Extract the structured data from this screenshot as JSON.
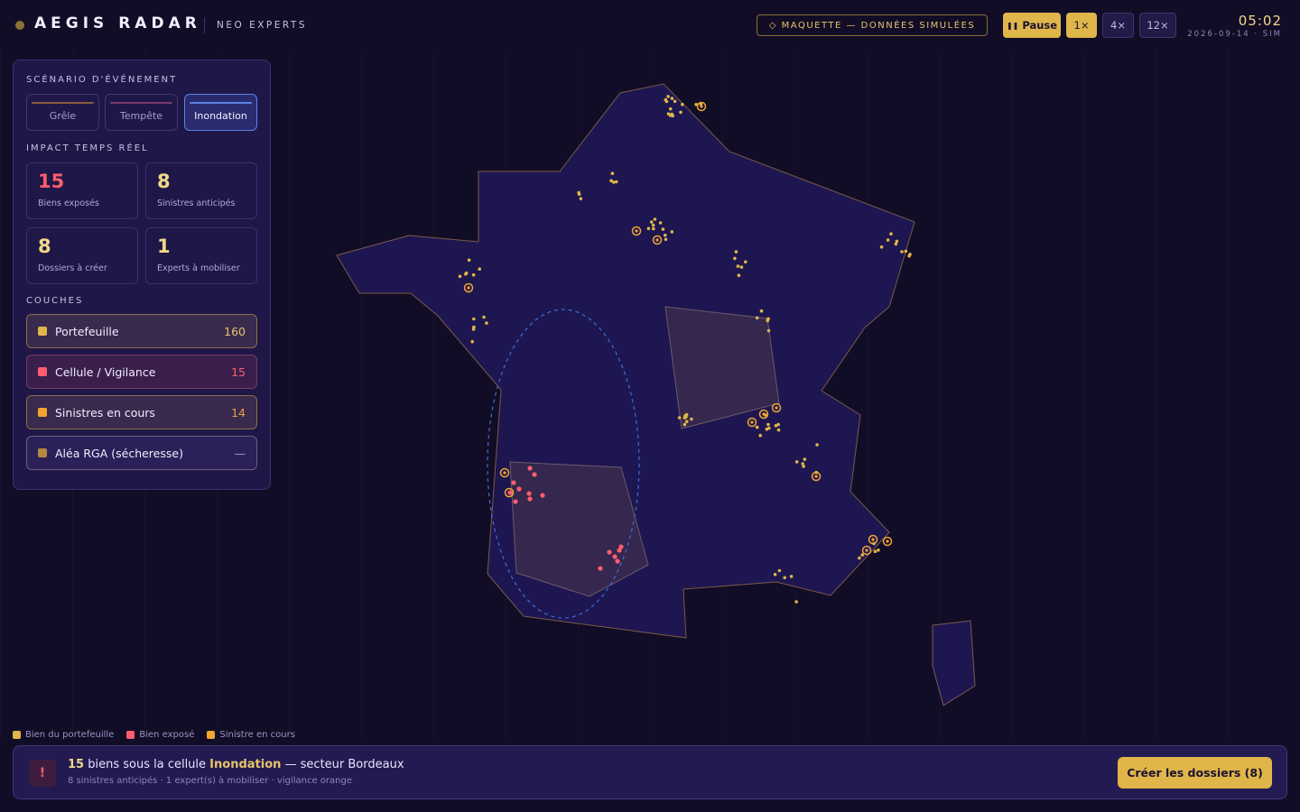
{
  "header": {
    "brand_name": "AEGIS RADAR",
    "brand_sub": "NEO EXPERTS",
    "mock_badge": "◇ MAQUETTE — DONNÉES SIMULÉES",
    "pause_label": "Pause",
    "speeds": [
      "1×",
      "4×",
      "12×"
    ],
    "active_speed": "1×",
    "clock": "05:02",
    "clock_sub": "2026-09-14 · SIM"
  },
  "sidebar": {
    "scenario_title": "SCÉNARIO D'ÉVÉNEMENT",
    "scenarios": [
      {
        "label": "Grêle",
        "color": "#8b5a3e",
        "active": false
      },
      {
        "label": "Tempête",
        "color": "#7a3a6a",
        "active": false
      },
      {
        "label": "Inondation",
        "color": "#5b84e6",
        "active": true
      }
    ],
    "impact_title": "IMPACT TEMPS RÉEL",
    "stats": [
      {
        "value": "15",
        "label": "Biens exposés",
        "color": "#ff5d6e"
      },
      {
        "value": "8",
        "label": "Sinistres anticipés",
        "color": "#f0d98a"
      },
      {
        "value": "8",
        "label": "Dossiers à créer",
        "color": "#f0d98a"
      },
      {
        "value": "1",
        "label": "Experts à mobiliser",
        "color": "#f0d98a"
      }
    ],
    "layers_title": "COUCHES",
    "layers": [
      {
        "label": "Portefeuille",
        "count": "160",
        "swatch": "#e0b54a",
        "bg": "#3a2a4e",
        "border": "#8a6f4a",
        "count_color": "#e7c46b"
      },
      {
        "label": "Cellule / Vigilance",
        "count": "15",
        "swatch": "#ff5d6e",
        "bg": "#3a1f4c",
        "border": "#7a3a5c",
        "count_color": "#ff5d6e"
      },
      {
        "label": "Sinistres en cours",
        "count": "14",
        "swatch": "#f2a531",
        "bg": "#3a2a4e",
        "border": "#8a6f4a",
        "count_color": "#e7a240"
      },
      {
        "label": "Aléa RGA (sécheresse)",
        "count": "—",
        "swatch": "#b3883f",
        "bg": "#2b2058",
        "border": "#6e5e7c",
        "count_color": "#a69dcd"
      }
    ]
  },
  "legend": [
    {
      "label": "Bien du portefeuille",
      "color": "#e0b54a"
    },
    {
      "label": "Bien exposé",
      "color": "#ff5d6e"
    },
    {
      "label": "Sinistre en cours",
      "color": "#f2a531"
    }
  ],
  "banner": {
    "icon": "!",
    "count": "15",
    "text_1": " biens sous la cellule ",
    "cell": "Inondation",
    "text_2": " — secteur Bordeaux",
    "sub": "8 sinistres anticipés · 1 expert(s) à mobiliser · vigilance orange",
    "cta": "Créer les dossiers (8)"
  },
  "colors": {
    "accent_gold": "#e0b54a",
    "alert_red": "#ff5d6e",
    "map_fill": "#1d1650",
    "map_stroke": "#7a5a4a",
    "cell_blue": "#3e6fd6"
  }
}
